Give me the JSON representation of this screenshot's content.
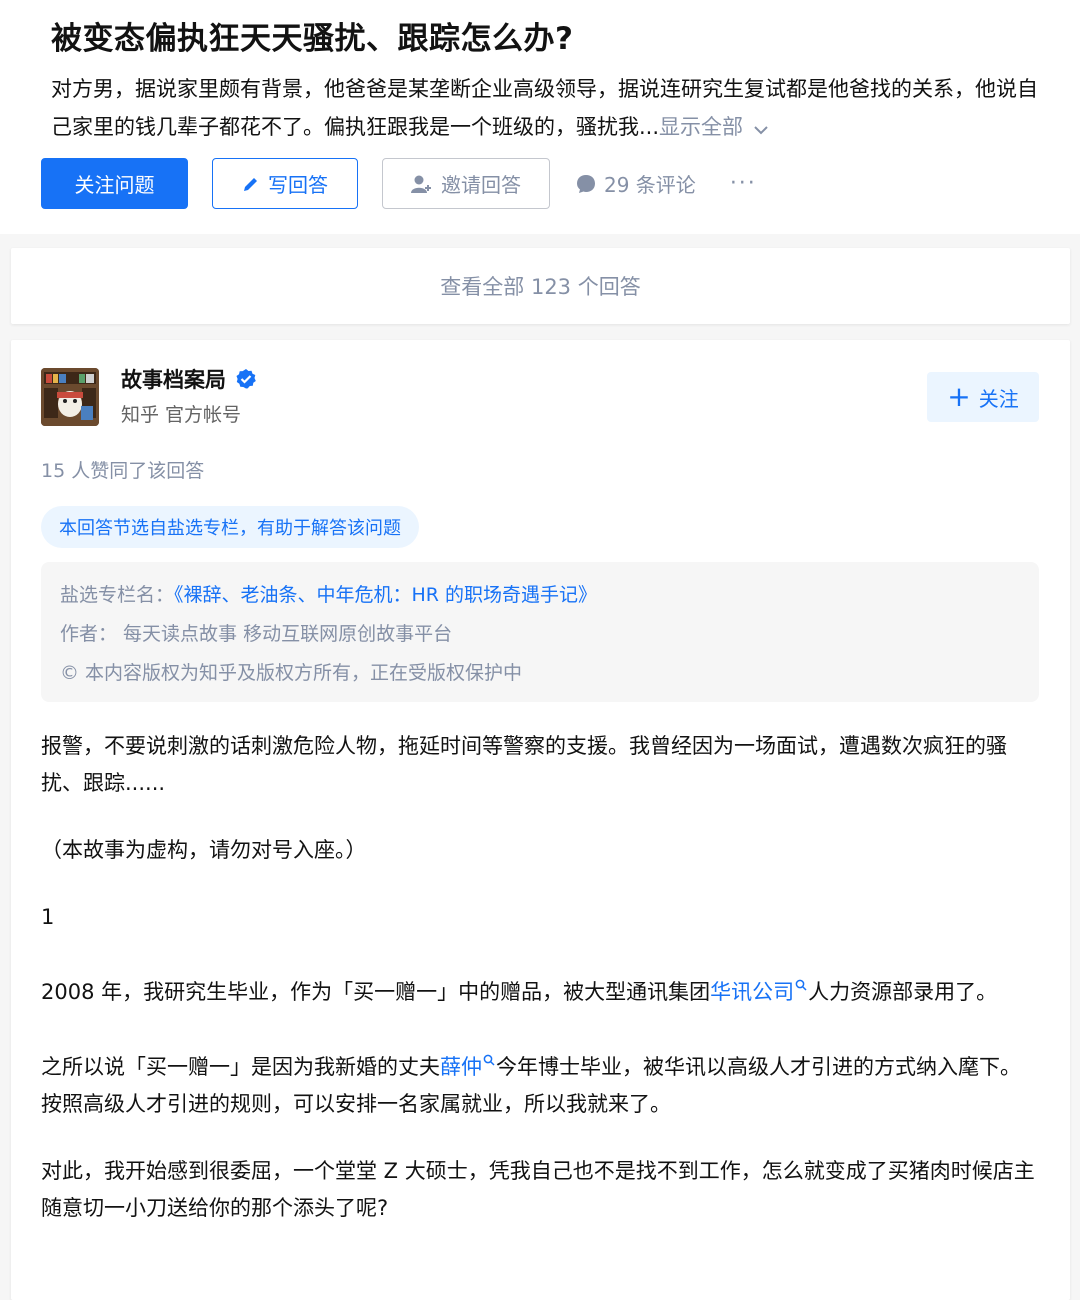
{
  "question": {
    "title": "被变态偏执狂天天骚扰、跟踪怎么办?",
    "description": "对方男，据说家里颇有背景，他爸爸是某垄断企业高级领导，据说连研究生复试都是他爸找的关系，他说自己家里的钱几辈子都花不了。偏执狂跟我是一个班级的，骚扰我...",
    "show_all": "显示全部"
  },
  "actions": {
    "follow_question": "关注问题",
    "write_answer": "写回答",
    "invite_answer": "邀请回答",
    "comments": "29 条评论",
    "more": "···"
  },
  "view_all": "查看全部 123 个回答",
  "answer": {
    "author_name": "故事档案局",
    "author_bio": "知乎 官方帐号",
    "follow_label": "关注",
    "votes": "15 人赞同了该回答",
    "tag": "本回答节选自盐选专栏，有助于解答该问题",
    "column_label": "盐选专栏名：",
    "column_name": "《裸辞、老油条、中年危机：HR 的职场奇遇手记》",
    "author_line": "作者：  每天读点故事 移动互联网原创故事平台",
    "copyright": "© 本内容版权为知乎及版权方所有，正在受版权保护中",
    "p1": "报警，不要说刺激的话刺激危险人物，拖延时间等警察的支援。我曾经因为一场面试，遭遇数次疯狂的骚扰、跟踪......",
    "p2": "（本故事为虚构，请勿对号入座。）",
    "p3": "1",
    "p4_a": "2008 年，我研究生毕业，作为「买一赠一」中的赠品，被大型通讯集团",
    "p4_link": "华讯公司",
    "p4_b": "人力资源部录用了。",
    "p5_a": "之所以说「买一赠一」是因为我新婚的丈夫",
    "p5_link": "薛仲",
    "p5_b": "今年博士毕业，被华讯以高级人才引进的方式纳入麾下。按照高级人才引进的规则，可以安排一名家属就业，所以我就来了。",
    "p6": "对此，我开始感到很委屈，一个堂堂 Z 大硕士，凭我自己也不是找不到工作，怎么就变成了买猪肉时候店主随意切一小刀送给你的那个添头了呢?"
  },
  "colors": {
    "brand_blue": "#1772f6",
    "muted": "#8590a6",
    "tag_bg": "#ebf5ff"
  }
}
